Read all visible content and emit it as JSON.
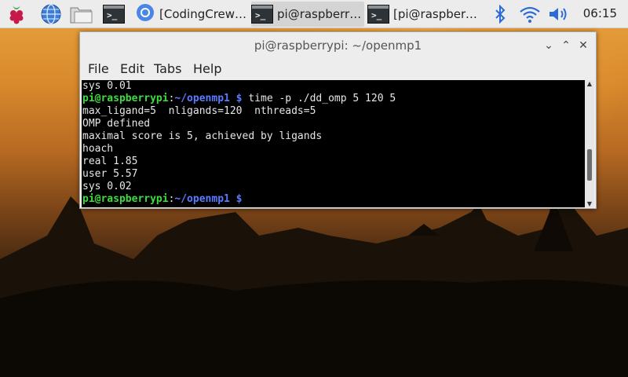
{
  "taskbar": {
    "launchers": [
      {
        "name": "raspberry-menu-icon"
      },
      {
        "name": "web-browser-icon"
      },
      {
        "name": "file-manager-icon"
      },
      {
        "name": "terminal-launcher-icon"
      }
    ],
    "tasks": [
      {
        "label": "[CodingCrew3…",
        "icon": "chromium-icon",
        "active": false
      },
      {
        "label": "pi@raspberry…",
        "icon": "terminal-icon",
        "active": true
      },
      {
        "label": "[pi@raspberryp…",
        "icon": "terminal-icon",
        "active": false
      }
    ],
    "tray": [
      "bluetooth-icon",
      "wifi-icon",
      "volume-icon"
    ],
    "clock": "06:15"
  },
  "terminal_window": {
    "title": "pi@raspberrypi: ~/openmp1",
    "controls": {
      "minimize": "⌄",
      "maximize": "⌃",
      "close": "✕"
    },
    "menu": [
      "File",
      "Edit",
      "Tabs",
      "Help"
    ],
    "prompt": {
      "user_host": "pi@raspberrypi",
      "sep": ":",
      "path": "~/openmp1",
      "dollar": " $"
    },
    "lines": [
      {
        "text": "sys 0.01"
      },
      {
        "prompt": true,
        "cmd": " time -p ./dd_omp 5 120 5"
      },
      {
        "text": "max_ligand=5  nligands=120  nthreads=5"
      },
      {
        "text": "OMP defined"
      },
      {
        "text": "maximal score is 5, achieved by ligands"
      },
      {
        "text": "hoach"
      },
      {
        "text": "real 1.85"
      },
      {
        "text": "user 5.57"
      },
      {
        "text": "sys 0.02"
      },
      {
        "prompt": true,
        "cmd": ""
      }
    ]
  },
  "colors": {
    "prompt_user": "#3fdc3f",
    "prompt_path": "#5a7bff",
    "terminal_bg": "#000000"
  }
}
